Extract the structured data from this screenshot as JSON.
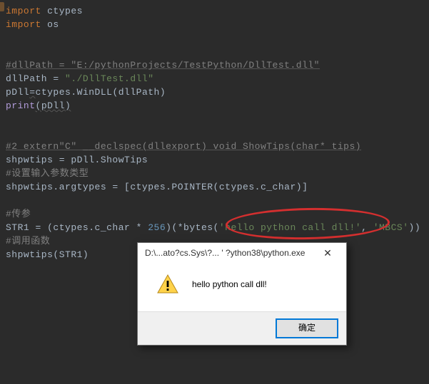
{
  "code": {
    "l1a": "import",
    "l1b": " ctypes",
    "l2a": "import",
    "l2b": " os",
    "l4": "#dllPath = \"E:/pythonProjects/TestPython/DllTest.dll\"",
    "l5a": "dllPath = ",
    "l5b": "\"./DllTest.dll\"",
    "l6a": "pDll",
    "l6b": "=",
    "l6c": "ctypes.WinDLL(dllPath)",
    "l7a": "print",
    "l7b": "(pDll)",
    "l9": "#2 extern\"C\" __declspec(dllexport) void ShowTips(char* tips)",
    "l10": "shpwtips = pDll.ShowTips",
    "l11": "#设置输入参数类型",
    "l12": "shpwtips.argtypes = [ctypes.POINTER(ctypes.c_char)]",
    "l14": "#传参",
    "l15a": "STR1 = (ctypes.c_char * ",
    "l15b": "256",
    "l15c": ")(*bytes(",
    "l15d": "'hello python call dll!'",
    "l15e": ", ",
    "l15f": "'MBCS'",
    "l15g": "))",
    "l16": "#调用函数",
    "l17": "shpwtips(STR1)"
  },
  "dialog": {
    "title": "D:\\...ato?cs.Sys\\?... ' ?ython38\\python.exe",
    "message": "hello python call dll!",
    "ok": "确定"
  }
}
